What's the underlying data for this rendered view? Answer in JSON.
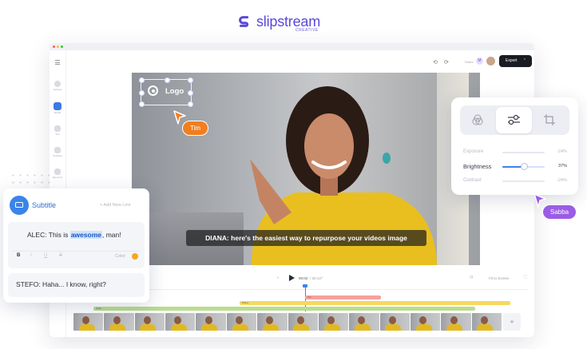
{
  "brand": {
    "name": "slipstream",
    "sub": "CREATIVE",
    "color": "#5a48d8"
  },
  "sidebar": {
    "items": [
      {
        "label": "Settings",
        "icon": "gear-icon"
      },
      {
        "label": "Media",
        "icon": "media-icon",
        "active": true
      },
      {
        "label": "Text",
        "icon": "text-icon"
      },
      {
        "label": "Subtitles",
        "icon": "subtitles-icon"
      },
      {
        "label": "Elements",
        "icon": "elements-icon"
      }
    ]
  },
  "toolbar": {
    "undo_icon": "undo-icon",
    "redo_icon": "redo-icon",
    "share_label": "Share",
    "avatar_initial": "M",
    "export_label": "Export"
  },
  "video": {
    "caption": "DIANA: here's the easiest way to repurpose your videos image",
    "logo_label": "Logo"
  },
  "collaborators": [
    {
      "name": "Tim",
      "color": "#f07f1f"
    },
    {
      "name": "Sabba",
      "color": "#9b5ce6"
    }
  ],
  "filters": {
    "tabs": [
      "color-filter-icon",
      "adjust-icon",
      "crop-icon"
    ],
    "active_tab": 1,
    "rows": [
      {
        "label": "Exposure",
        "value": "-24%",
        "level": 0
      },
      {
        "label": "Brightness",
        "value": "37%",
        "level": 0.5
      },
      {
        "label": "Contrast",
        "value": "-24%",
        "level": 0
      }
    ]
  },
  "subtitle_panel": {
    "title": "Subtitle",
    "add_label": "+ Add New Line",
    "line1_prefix": "ALEC: This is ",
    "line1_highlight": "awesome",
    "line1_suffix": ", man!",
    "format_buttons": [
      "B",
      "I",
      "U",
      "S"
    ],
    "color_label": "Color",
    "color_value": "#f5a623",
    "line2": "STEFO: Haha... I know, right?"
  },
  "player": {
    "timecode": "00:02",
    "duration": "/ 00:13",
    "fit_label": "Fit to Screen"
  },
  "timeline": {
    "tracks": [
      {
        "label": "Tim",
        "color": "#f3a29a"
      },
      {
        "label": "Diana",
        "color": "#f6d860"
      },
      {
        "label": "Stefo",
        "color": "#b9dd8f"
      }
    ],
    "add_label": "+"
  }
}
